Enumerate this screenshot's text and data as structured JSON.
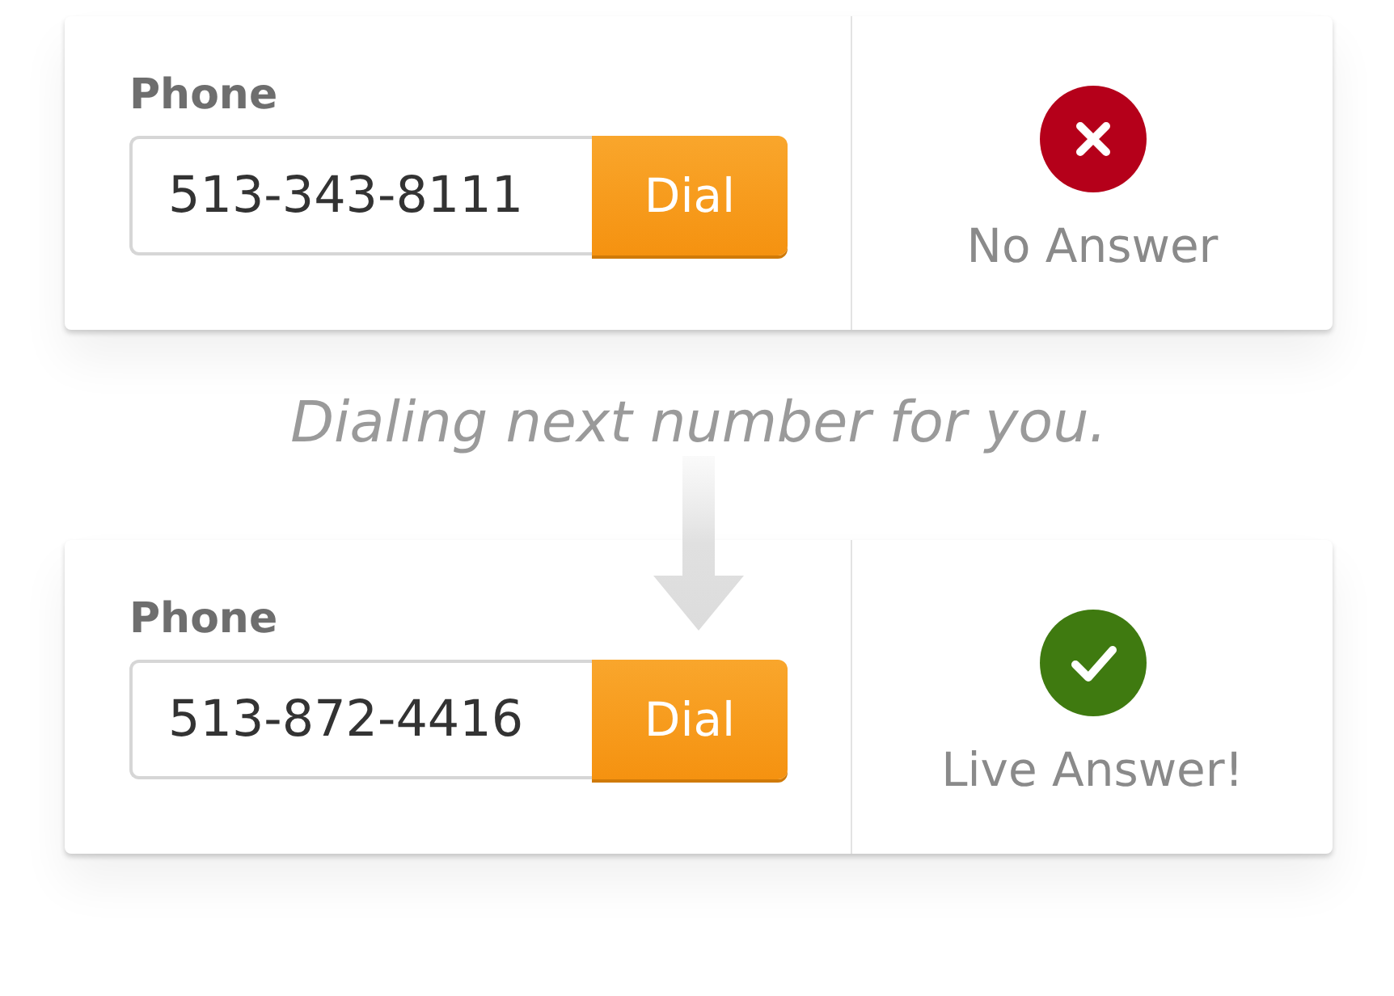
{
  "calls": [
    {
      "label": "Phone",
      "number": "513-343-8111",
      "button": "Dial",
      "kind": "failed",
      "result": "No Answer"
    },
    {
      "label": "Phone",
      "number": "513-872-4416",
      "button": "Dial",
      "kind": "success",
      "result": "Live Answer!"
    }
  ],
  "message": "Dialing next number for you."
}
